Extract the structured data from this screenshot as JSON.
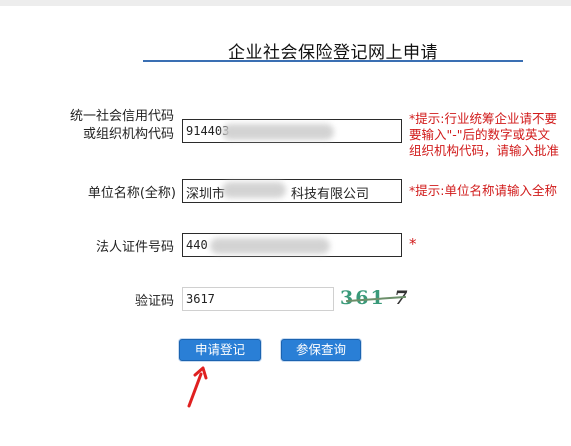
{
  "header": {
    "title": "企业社会保险登记网上申请"
  },
  "form": {
    "credit_code": {
      "label_line1": "统一社会信用代码",
      "label_line2": "或组织机构代码",
      "value": "914403",
      "hint_line1": "*提示:行业统筹企业请不要",
      "hint_line2": "要输入\"-\"后的数字或英文",
      "hint_line3": "组织机构代码，请输入批准"
    },
    "unit_name": {
      "label": "单位名称(全称)",
      "value_prefix": "深圳市",
      "value_suffix": "科技有限公司",
      "hint": "*提示:单位名称请输入全称"
    },
    "legal_id": {
      "label": "法人证件号码",
      "value": "440",
      "required_mark": "*"
    },
    "captcha": {
      "label": "验证码",
      "value": "3617",
      "image_text_a": "361",
      "image_text_b": "7"
    }
  },
  "buttons": {
    "register": "申请登记",
    "query": "参保查询"
  },
  "colors": {
    "accent": "#2a7fd6",
    "hint_red": "#d11b1b",
    "annotation_red": "#e02020"
  }
}
